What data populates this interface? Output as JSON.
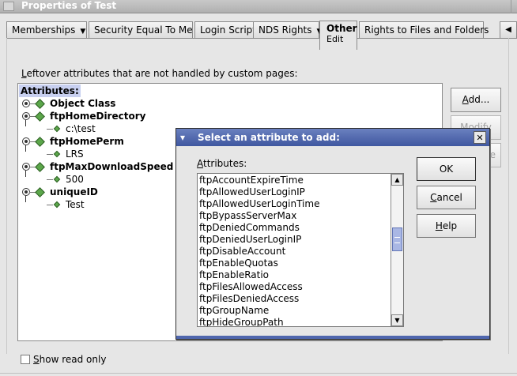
{
  "window": {
    "title": "Properties of Test"
  },
  "tabs": [
    {
      "label": "Memberships",
      "has_dropdown": true
    },
    {
      "label": "Security Equal To Me",
      "has_dropdown": false
    },
    {
      "label": "Login Script",
      "has_dropdown": false
    },
    {
      "label": "NDS Rights",
      "has_dropdown": true
    },
    {
      "label": "Other",
      "sub": "Edit",
      "active": true
    },
    {
      "label": "Rights to Files and Folders",
      "has_dropdown": false
    }
  ],
  "main": {
    "heading_first": "L",
    "heading_rest": "eftover attributes that are not handled by custom pages:",
    "tree_header": "Attributes:",
    "tree": [
      {
        "name": "Object Class",
        "values": []
      },
      {
        "name": "ftpHomeDirectory",
        "values": [
          "c:\\test"
        ]
      },
      {
        "name": "ftpHomePerm",
        "values": [
          "LRS"
        ]
      },
      {
        "name": "ftpMaxDownloadSpeed",
        "values": [
          "500"
        ]
      },
      {
        "name": "uniqueID",
        "values": [
          "Test"
        ]
      }
    ],
    "buttons": {
      "add": {
        "label_first": "A",
        "label_rest": "dd..."
      },
      "modify": {
        "label": "Modify"
      },
      "remove": {
        "label": "e"
      }
    },
    "show_read_only": {
      "label_first": "S",
      "label_rest": "how read only",
      "checked": false
    }
  },
  "dialog": {
    "title": "Select an attribute to add:",
    "list_label_first": "A",
    "list_label_rest": "ttributes:",
    "items": [
      "ftpAccountExpireTime",
      "ftpAllowedUserLoginIP",
      "ftpAllowedUserLoginTime",
      "ftpBypassServerMax",
      "ftpDeniedCommands",
      "ftpDeniedUserLoginIP",
      "ftpDisableAccount",
      "ftpEnableQuotas",
      "ftpEnableRatio",
      "ftpFilesAllowedAccess",
      "ftpFilesDeniedAccess",
      "ftpGroupName",
      "ftpHideGroupPath"
    ],
    "buttons": {
      "ok": "OK",
      "cancel_first": "C",
      "cancel_rest": "ancel",
      "help_first": "H",
      "help_rest": "elp"
    }
  },
  "colors": {
    "dialog_title": "#4f66ad",
    "tree_header_highlight": "#c8d0f0",
    "node_icon": "#5ba64a",
    "scroll_thumb": "#a9b7e4"
  }
}
